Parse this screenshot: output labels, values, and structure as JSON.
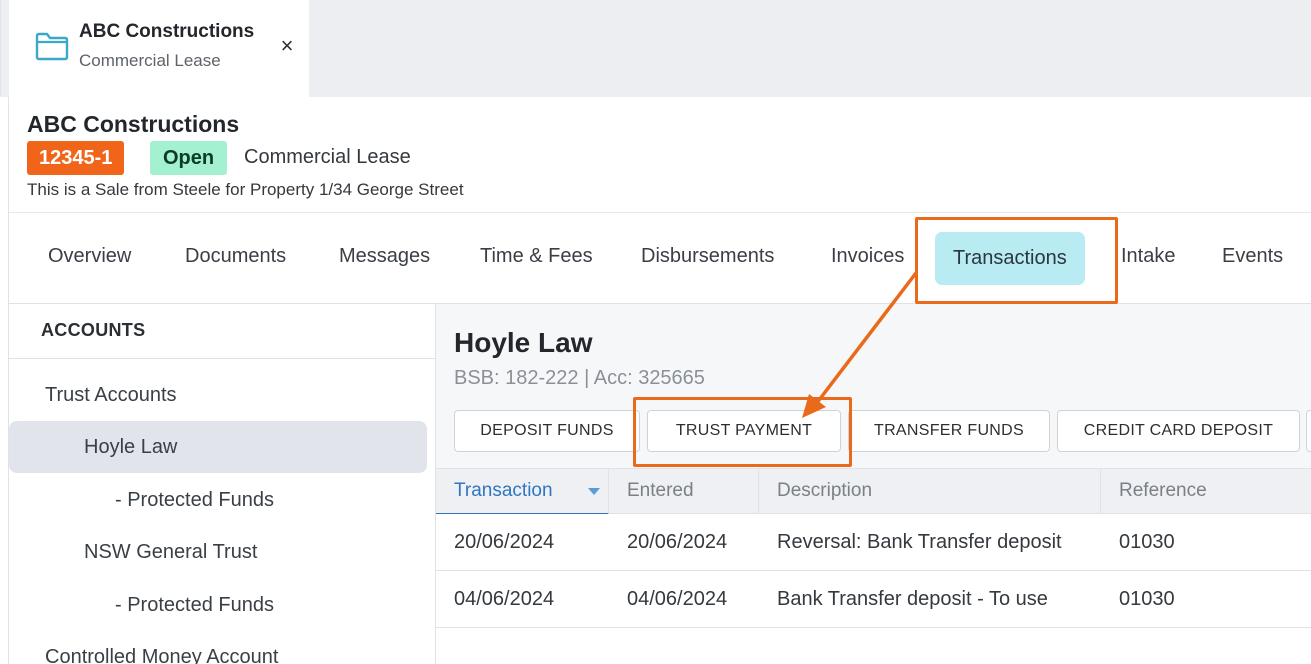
{
  "tab": {
    "title": "ABC Constructions",
    "subtitle": "Commercial Lease",
    "close_glyph": "×",
    "icon": "folder-icon",
    "close_icon": "close-icon"
  },
  "matter": {
    "title": "ABC Constructions",
    "number": "12345-1",
    "status": "Open",
    "type": "Commercial Lease",
    "description": "This is a Sale from Steele for Property 1/34 George Street"
  },
  "nav": {
    "items": [
      "Overview",
      "Documents",
      "Messages",
      "Time & Fees",
      "Disbursements",
      "Invoices",
      "Transactions",
      "Intake",
      "Events"
    ],
    "active": "Transactions"
  },
  "sidebar": {
    "header": "ACCOUNTS",
    "items": [
      "Trust Accounts",
      "Hoyle Law",
      "- Protected Funds",
      "NSW General Trust",
      "- Protected Funds",
      "Controlled Money Account"
    ],
    "selected": "Hoyle Law"
  },
  "account": {
    "name": "Hoyle Law",
    "info": "BSB: 182-222 | Acc: 325665"
  },
  "actions": [
    "DEPOSIT FUNDS",
    "TRUST PAYMENT",
    "TRANSFER FUNDS",
    "CREDIT CARD DEPOSIT"
  ],
  "table": {
    "columns": [
      "Transaction",
      "Entered",
      "Description",
      "Reference"
    ],
    "rows": [
      [
        "20/06/2024",
        "20/06/2024",
        "Reversal: Bank Transfer deposit",
        "01030"
      ],
      [
        "04/06/2024",
        "04/06/2024",
        "Bank Transfer deposit - To use",
        "01030"
      ]
    ]
  },
  "colors": {
    "annotation": "#ea6a1c",
    "matter_number_bg": "#f0651a",
    "status_bg": "#a3f1d0",
    "active_tab_bg": "#b9ebf2",
    "selected_item_bg": "#e1e4ea",
    "sort_accent": "#2f76c2",
    "folder_icon": "#3aa9c7"
  }
}
